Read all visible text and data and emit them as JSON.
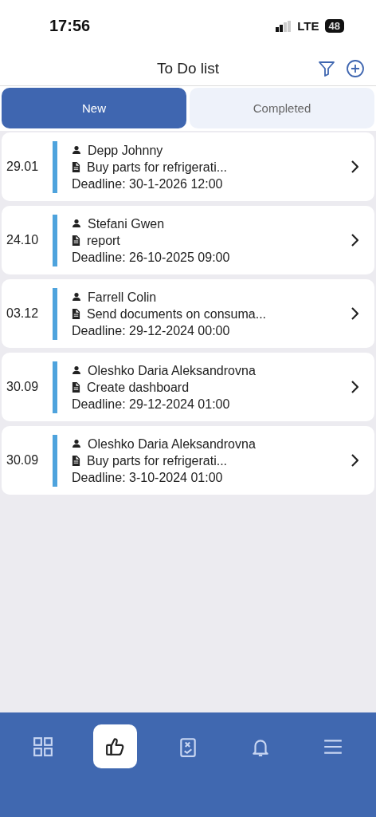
{
  "status_bar": {
    "time": "17:56",
    "network": "LTE",
    "battery": "48"
  },
  "header": {
    "title": "To Do list"
  },
  "tabs": [
    {
      "label": "New",
      "selected": true
    },
    {
      "label": "Completed",
      "selected": false
    }
  ],
  "tasks": [
    {
      "date": "29.01",
      "person": "Depp Johnny",
      "task": "Buy parts for refrigerati...",
      "deadline": "Deadline: 30-1-2026 12:00"
    },
    {
      "date": "24.10",
      "person": "Stefani Gwen",
      "task": "report",
      "deadline": "Deadline: 26-10-2025 09:00"
    },
    {
      "date": "03.12",
      "person": "Farrell Colin",
      "task": "Send documents on consuma...",
      "deadline": "Deadline: 29-12-2024 00:00"
    },
    {
      "date": "30.09",
      "person": "Oleshko Daria Aleksandrovna",
      "task": "Create dashboard",
      "deadline": "Deadline: 29-12-2024 01:00"
    },
    {
      "date": "30.09",
      "person": "Oleshko Daria Aleksandrovna",
      "task": "Buy parts for refrigerati...",
      "deadline": "Deadline: 3-10-2024 01:00"
    }
  ],
  "nav": [
    {
      "kind": "grid",
      "selected": false
    },
    {
      "kind": "like",
      "selected": true
    },
    {
      "kind": "checklist",
      "selected": false
    },
    {
      "kind": "bell",
      "selected": false
    },
    {
      "kind": "menu",
      "selected": false
    }
  ]
}
